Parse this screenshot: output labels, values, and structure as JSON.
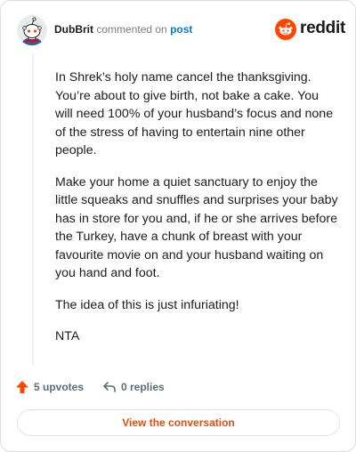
{
  "header": {
    "username": "DubBrit",
    "action": "commented on",
    "target": "post",
    "logo_text": "reddit"
  },
  "comment": {
    "paragraphs": [
      "In Shrek’s holy name cancel the thanksgiving. You’re about to give birth, not bake a cake. You will need 100% of your husband’s focus and none of the stress of having to entertain nine other people.",
      "Make your home a quiet sanctuary to enjoy the little squeaks and snuffles and surprises your baby has in store for you and, if he or she arrives before the Turkey, have a chunk of breast with your favourite movie on and your husband waiting on you hand and foot.",
      "The idea of this is just infuriating!",
      "NTA"
    ]
  },
  "actions": {
    "upvotes": "5 upvotes",
    "replies": "0 replies"
  },
  "cta": {
    "label": "View the conversation"
  },
  "colors": {
    "brand": "#ff4500",
    "link": "#0079d3",
    "cta_text": "#e54b0a",
    "muted": "#576f76"
  },
  "icons": [
    "snoo-avatar-icon",
    "reddit-logo-icon",
    "upvote-arrow-icon",
    "reply-arrow-icon"
  ]
}
